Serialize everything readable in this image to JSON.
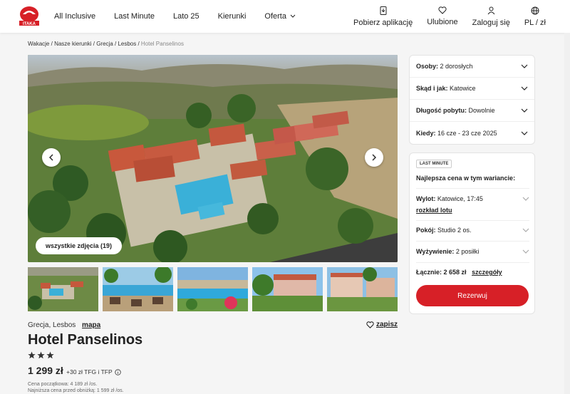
{
  "brand": {
    "name": "ITAKA",
    "color": "#d72027"
  },
  "nav": {
    "items": [
      "All Inclusive",
      "Last Minute",
      "Lato 25",
      "Kierunki",
      "Oferta"
    ]
  },
  "right_nav": {
    "app": "Pobierz aplikację",
    "favorites": "Ulubione",
    "login": "Zaloguj się",
    "lang": "PL / zł"
  },
  "breadcrumb": {
    "items": [
      "Wakacje",
      "Nasze kierunki",
      "Grecja",
      "Lesbos"
    ],
    "current": "Hotel Panselinos"
  },
  "gallery": {
    "all_photos": "wszystkie zdjęcia (19)"
  },
  "hotel": {
    "location": "Grecja, Lesbos",
    "map_link": "mapa",
    "save": "zapisz",
    "name": "Hotel Panselinos",
    "stars": 3,
    "price": "1 299 zł",
    "price_extra": "+30 zł TFG i TFP",
    "start_price": "Cena początkowa: 4 189 zł /os.",
    "lowest_price": "Najniższa cena przed obniżką: 1 599 zł /os."
  },
  "filters": [
    {
      "label": "Osoby:",
      "value": "2 dorosłych"
    },
    {
      "label": "Skąd i jak:",
      "value": "Katowice"
    },
    {
      "label": "Długość pobytu:",
      "value": "Dowolnie"
    },
    {
      "label": "Kiedy:",
      "value": "16 cze - 23 cze 2025"
    }
  ],
  "offer": {
    "badge": "LAST MINUTE",
    "best": "Najlepsza cena w tym wariancie:",
    "departure_label": "Wylot:",
    "departure_value": "Katowice, 17:45",
    "flight_schedule": "rozkład lotu",
    "room_label": "Pokój:",
    "room_value": "Studio 2 os.",
    "board_label": "Wyżywienie:",
    "board_value": "2 posiłki",
    "total_label": "Łącznie: 2 658 zł",
    "details": "szczegóły",
    "reserve": "Rezerwuj"
  }
}
